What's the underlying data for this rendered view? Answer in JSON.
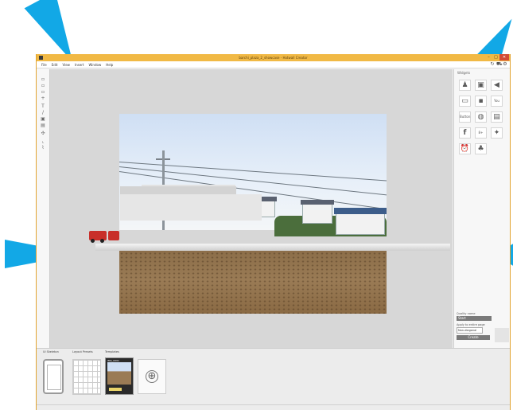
{
  "window": {
    "title": "barchi_plaza_2_showcase - Hotwall Creator"
  },
  "window_buttons": {
    "minimize": "–",
    "maximize": "□",
    "close": "✕"
  },
  "menu": [
    "File",
    "Edit",
    "View",
    "Insert",
    "Window",
    "Help"
  ],
  "top_icons": [
    "refresh-icon",
    "cart-icon",
    "gear-icon"
  ],
  "left_tools": [
    "select-icon",
    "move-icon",
    "rotate-icon",
    "zoom-icon",
    "text-icon",
    "pen-icon",
    "image-icon",
    "layer-icon",
    "link-icon",
    "crop-icon",
    "path-icon"
  ],
  "right_panel": {
    "title": "Widgets",
    "widgets": [
      {
        "name": "person-widget",
        "glyph": "♟"
      },
      {
        "name": "image-widget",
        "glyph": "▣"
      },
      {
        "name": "speaker-widget",
        "glyph": "◀"
      },
      {
        "name": "tablet-widget",
        "glyph": "▭"
      },
      {
        "name": "video-widget",
        "glyph": "▪"
      },
      {
        "name": "youtube-widget",
        "glyph": "You"
      },
      {
        "name": "button-widget",
        "glyph": "Button"
      },
      {
        "name": "globe-widget",
        "glyph": "◍"
      },
      {
        "name": "gallery-widget",
        "glyph": "▤"
      },
      {
        "name": "facebook-widget",
        "glyph": "f"
      },
      {
        "name": "googleplus-widget",
        "glyph": "8+"
      },
      {
        "name": "twitter-widget",
        "glyph": "✦"
      },
      {
        "name": "alarm-widget",
        "glyph": "⏰"
      },
      {
        "name": "group-widget",
        "glyph": "♣"
      }
    ],
    "scene_label": "Quality name",
    "scene_btn": "Start",
    "apply_label": "Apply to entire page",
    "select_value": "Non-diagonal",
    "create_btn": "Create"
  },
  "bottom": {
    "device_label": "Ui Skeleton",
    "layout_label": "Layout Presets",
    "template_label": "Templates",
    "template_tag": "IMG_0001",
    "add_symbol": "⊕"
  },
  "colors": {
    "accent": "#f1b945",
    "arrow": "#12a8e6",
    "canvas": "#d7d7d7"
  }
}
